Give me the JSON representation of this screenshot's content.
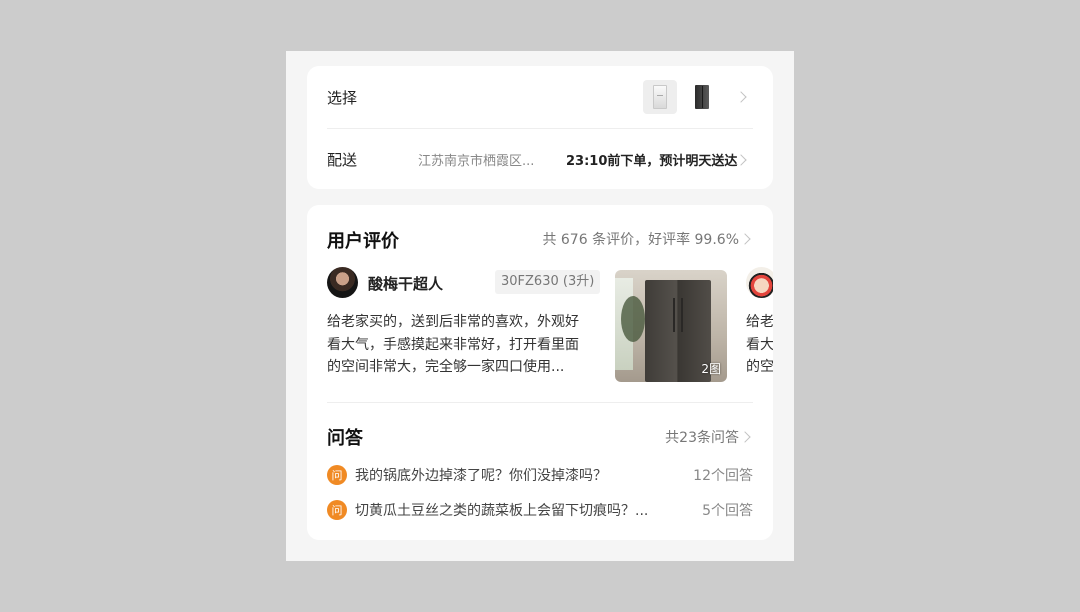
{
  "selection": {
    "label": "选择",
    "thumbnails": [
      "refrigerator-white",
      "refrigerator-black"
    ]
  },
  "shipping": {
    "label": "配送",
    "address": "江苏南京市栖霞区...",
    "eta": "23:10前下单，预计明天送达"
  },
  "reviews": {
    "title": "用户评价",
    "summary": "共 676 条评价，好评率 99.6%",
    "items": [
      {
        "name": "酸梅干超人",
        "variant": "30FZ630 (3升)",
        "lines": [
          "给老家买的，送到后非常的喜欢，外观好",
          "看大气，手感摸起来非常好，打开看里面",
          "的空间非常大，完全够一家四口使用..."
        ],
        "photo_count": "2图"
      }
    ],
    "peek_lines": [
      "给老",
      "看大",
      "的空"
    ]
  },
  "qa": {
    "title": "问答",
    "summary": "共23条问答",
    "badge": "问",
    "items": [
      {
        "question": "我的锅底外边掉漆了呢？你们没掉漆吗？",
        "count": "12个回答"
      },
      {
        "question": "切黄瓜土豆丝之类的蔬菜板上会留下切痕吗？...",
        "count": "5个回答"
      }
    ]
  },
  "colors": {
    "accent": "#f08a24",
    "background": "#f5f5f5",
    "card": "#ffffff"
  }
}
